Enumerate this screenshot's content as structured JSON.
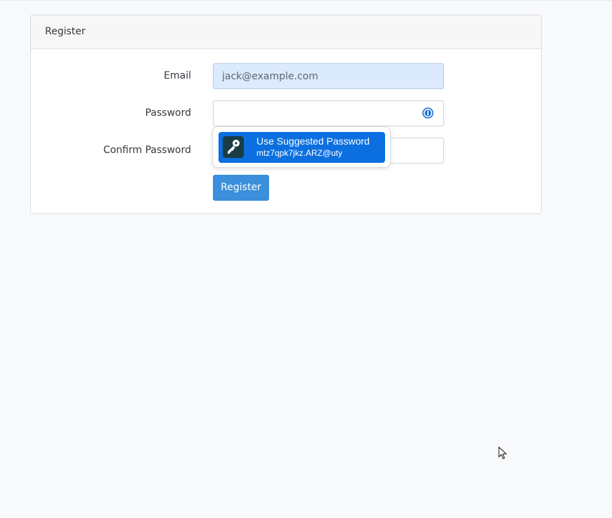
{
  "card": {
    "title": "Register"
  },
  "form": {
    "email_label": "Email",
    "email_value": "jack@example.com",
    "password_label": "Password",
    "password_value": "",
    "confirm_label": "Confirm Password",
    "confirm_value": "",
    "submit_label": "Register"
  },
  "password_manager": {
    "field_icon": "password-manager-icon",
    "suggestion_title": "Use Suggested Password",
    "suggested_password": "mtz7qpk7jkz.ARZ@uty",
    "suggestion_icon": "key-icon"
  },
  "colors": {
    "primary_button": "#3b8fdc",
    "suggestion_bg": "#0b6fe0",
    "autofill_bg": "#dbeafc"
  }
}
